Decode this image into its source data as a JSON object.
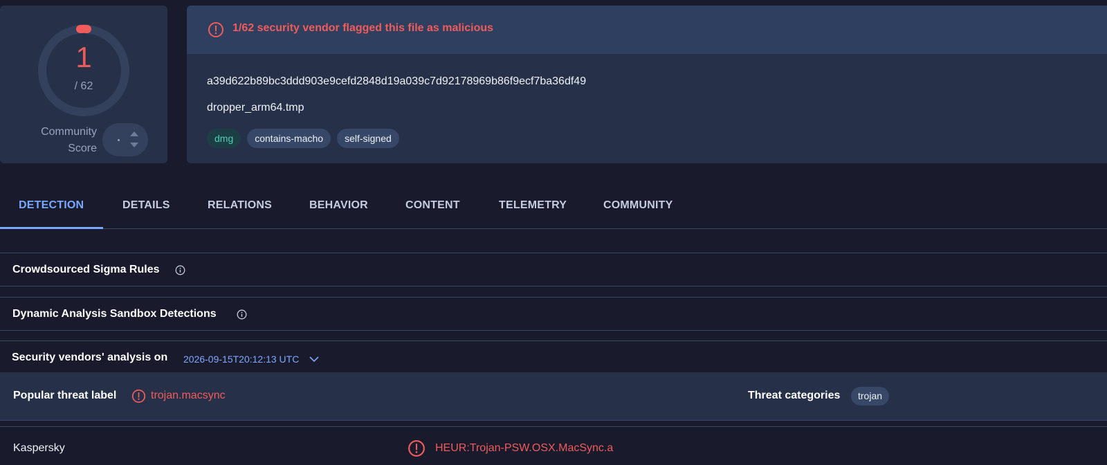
{
  "score": {
    "detections": "1",
    "total": "/ 62",
    "community_label": "Community Score",
    "community_value": "·"
  },
  "file": {
    "alert": "1/62 security vendor flagged this file as malicious",
    "hash": "a39d622b89bc3ddd903e9cefd2848d19a039c7d92178969b86f9ecf7ba36df49",
    "name": "dropper_arm64.tmp",
    "tags": [
      "dmg",
      "contains-macho",
      "self-signed"
    ]
  },
  "tabs": [
    "DETECTION",
    "DETAILS",
    "RELATIONS",
    "BEHAVIOR",
    "CONTENT",
    "TELEMETRY",
    "COMMUNITY"
  ],
  "active_tab": "DETECTION",
  "sections": {
    "sigma": "Crowdsourced Sigma Rules",
    "sandbox": "Dynamic Analysis Sandbox Detections",
    "vendors_title": "Security vendors' analysis on",
    "vendors_date": "2026-09-15T20:12:13 UTC"
  },
  "threat": {
    "label": "Popular threat label",
    "value": "trojan.macsync",
    "categories_label": "Threat categories",
    "category": "trojan"
  },
  "vendor_results": [
    {
      "vendor": "Kaspersky",
      "result": "HEUR:Trojan-PSW.OSX.MacSync.a"
    }
  ],
  "colors": {
    "background": "#191a2b",
    "card": "#263149",
    "malicious": "#f05b5b",
    "accent": "#79a8ff"
  },
  "icons": {
    "alert": "exclamation-circle-icon",
    "info": "info-circle-icon",
    "chevron": "chevron-down-icon"
  }
}
